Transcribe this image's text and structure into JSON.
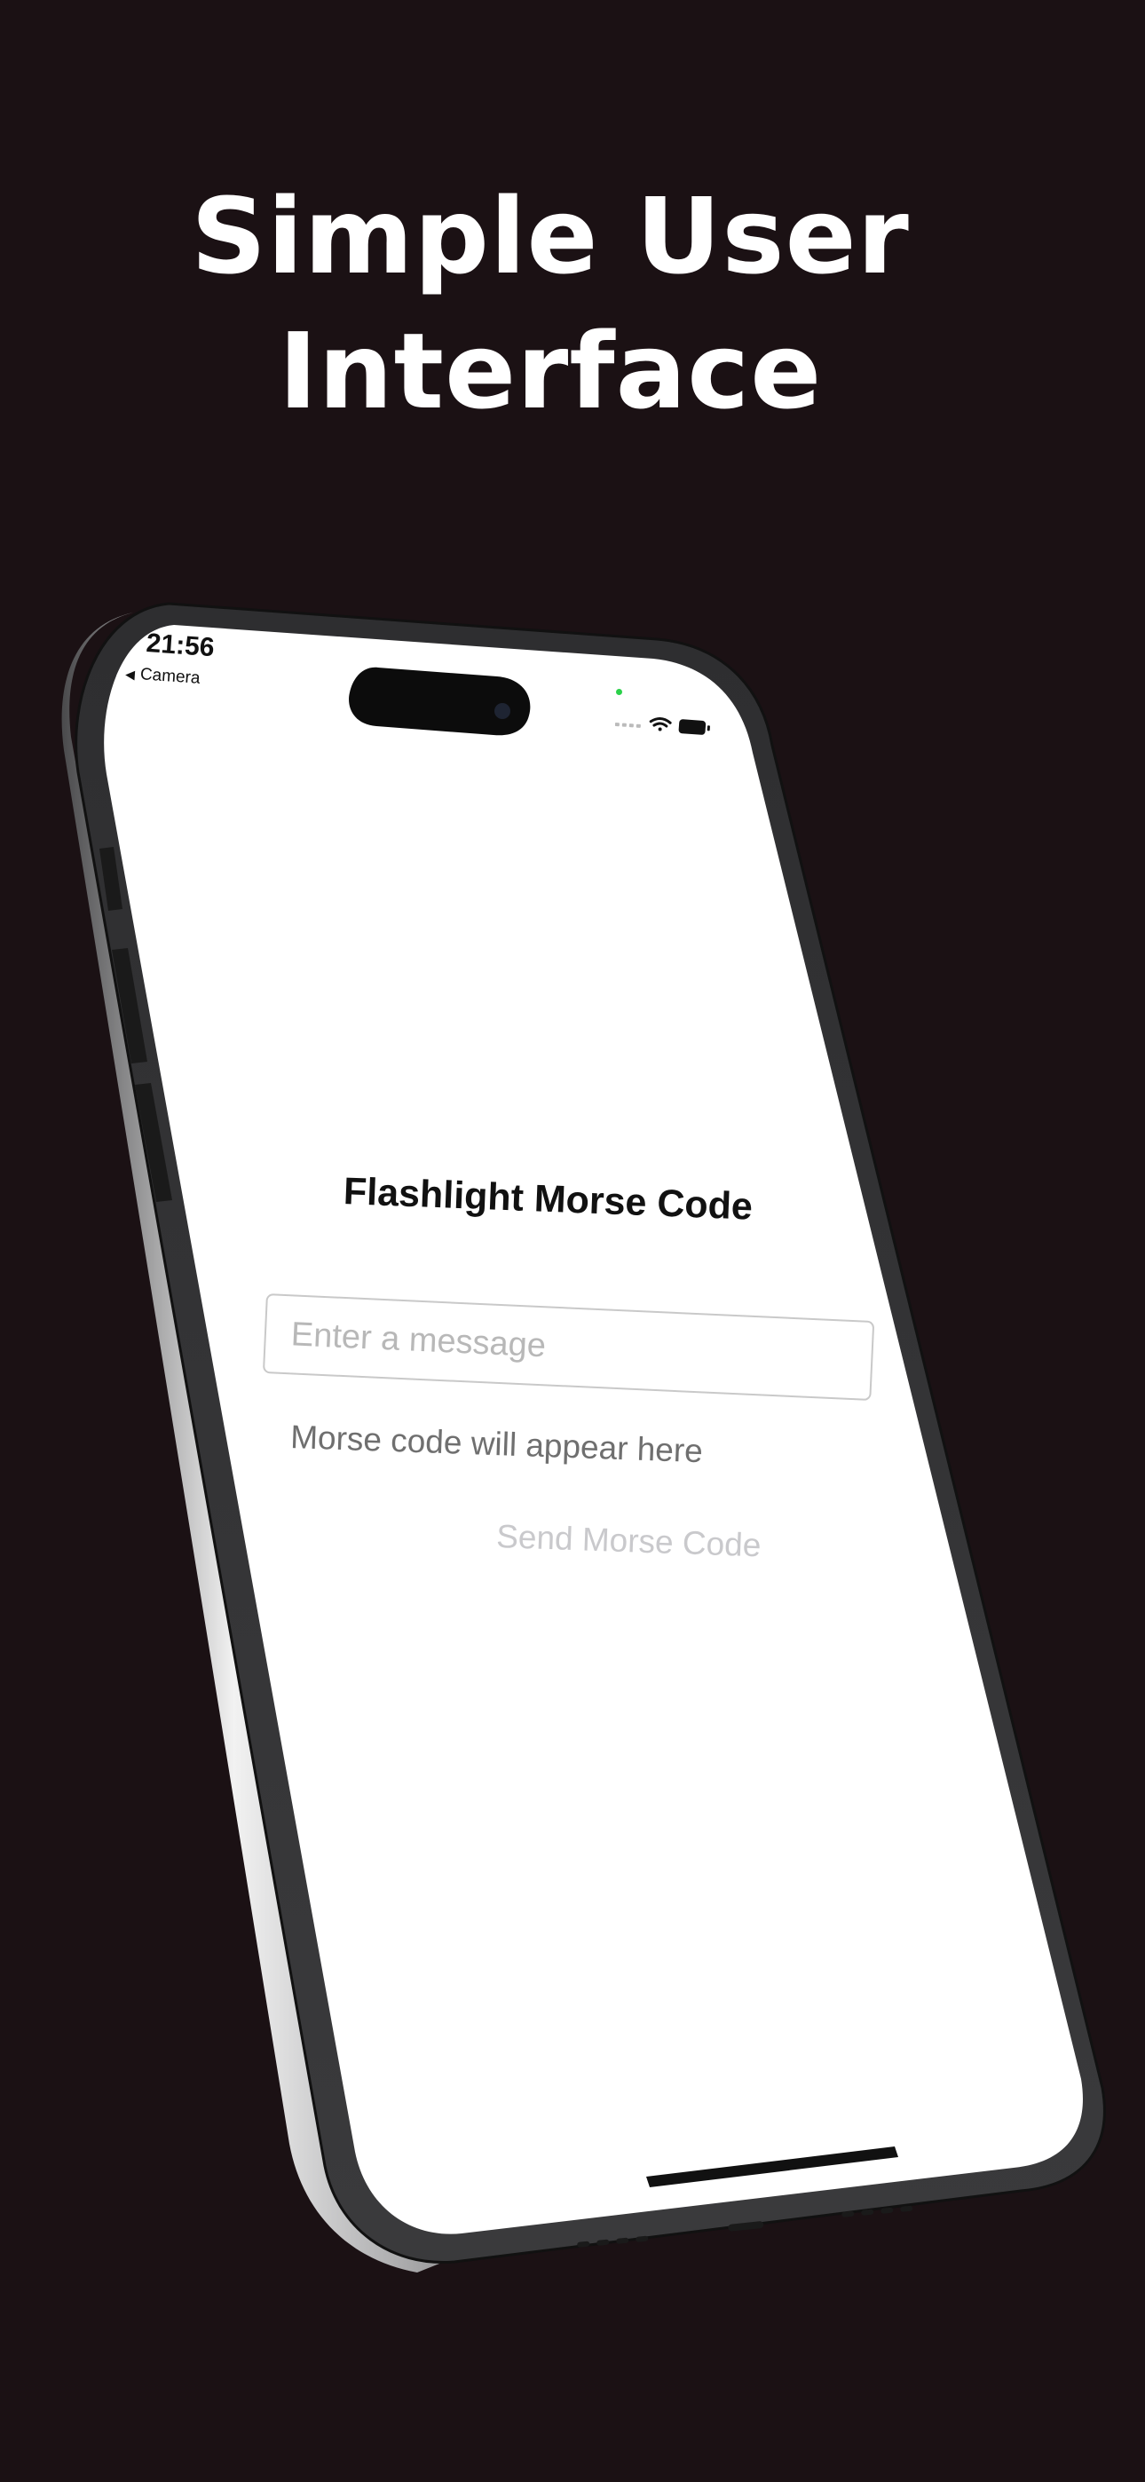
{
  "headline": {
    "line1": "Simple User",
    "line2": "Interface"
  },
  "status_bar": {
    "time": "21:56",
    "back_label": "Camera",
    "icons": [
      "signal-icon",
      "wifi-icon",
      "battery-icon"
    ]
  },
  "app": {
    "title": "Flashlight Morse Code",
    "message_input": {
      "value": "",
      "placeholder": "Enter a message"
    },
    "morse_output": "Morse code will appear here",
    "send_button_label": "Send Morse Code"
  },
  "colors": {
    "background": "#1b1114",
    "headline_text": "#ffffff",
    "screen": "#ffffff",
    "frame": "#2a2a2c",
    "send_button_disabled": "#c9c9cc"
  }
}
